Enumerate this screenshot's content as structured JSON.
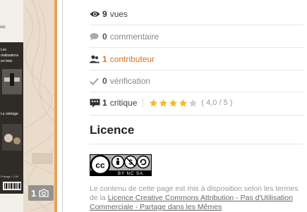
{
  "image_panel": {
    "photo_count": "1",
    "card_texts": [
      "ois",
      "Les",
      "réalisations",
      "en bois",
      "Le cintrage",
      "Portage : 0.90"
    ]
  },
  "stats": {
    "views": {
      "count": "9",
      "label": "vues",
      "icon": "eye-icon"
    },
    "comments": {
      "count": "0",
      "label": "commentaire",
      "icon": "comment-icon"
    },
    "contributors": {
      "count": "1",
      "label": "contributeur",
      "icon": "users-icon"
    },
    "verifications": {
      "count": "0",
      "label": "vérification",
      "icon": "check-icon"
    },
    "reviews": {
      "count": "1",
      "label": "critique",
      "icon": "review-icon",
      "rating_text": "( 4,0 / 5 )",
      "rating": 4,
      "rating_max": 5
    }
  },
  "licence": {
    "title": "Licence",
    "badge_label": "BY NC SA",
    "text_before": "Le contenu de cette page est mis à disposition selon les termes de la ",
    "link_text": "Licence Creative Commons Attribution - Pas d'Utilisation Commerciale - Partage dans les Mêmes"
  },
  "colors": {
    "accent": "#e0701e",
    "star": "#f2b930",
    "text_muted": "#888888"
  }
}
